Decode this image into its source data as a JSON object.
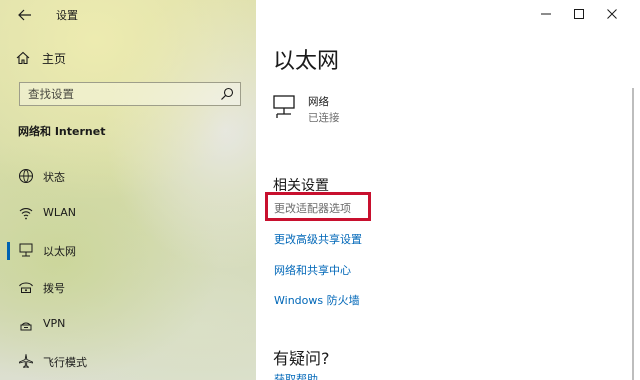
{
  "window": {
    "title": "设置",
    "caption": {
      "minimize": "—",
      "maximize": "☐",
      "close": "✕"
    }
  },
  "sidebar": {
    "home_label": "主页",
    "search": {
      "placeholder": "查找设置",
      "value": ""
    },
    "section_title": "网络和 Internet",
    "items": [
      {
        "label": "状态",
        "icon": "status-icon"
      },
      {
        "label": "WLAN",
        "icon": "wlan-icon"
      },
      {
        "label": "以太网",
        "icon": "ethernet-icon",
        "selected": true
      },
      {
        "label": "拨号",
        "icon": "dialup-icon"
      },
      {
        "label": "VPN",
        "icon": "vpn-icon"
      },
      {
        "label": "飞行模式",
        "icon": "airplane-icon"
      }
    ]
  },
  "main": {
    "title": "以太网",
    "network": {
      "name": "网络",
      "status": "已连接"
    },
    "related": {
      "title": "相关设置",
      "links": [
        {
          "label": "更改适配器选项",
          "highlighted": true
        },
        {
          "label": "更改高级共享设置"
        },
        {
          "label": "网络和共享中心"
        },
        {
          "label": "Windows 防火墙"
        }
      ]
    },
    "help": {
      "title": "有疑问?",
      "link": "获取帮助"
    }
  },
  "colors": {
    "accent": "#0063b1",
    "link": "#0067b8",
    "highlight_box": "#c8102e"
  }
}
